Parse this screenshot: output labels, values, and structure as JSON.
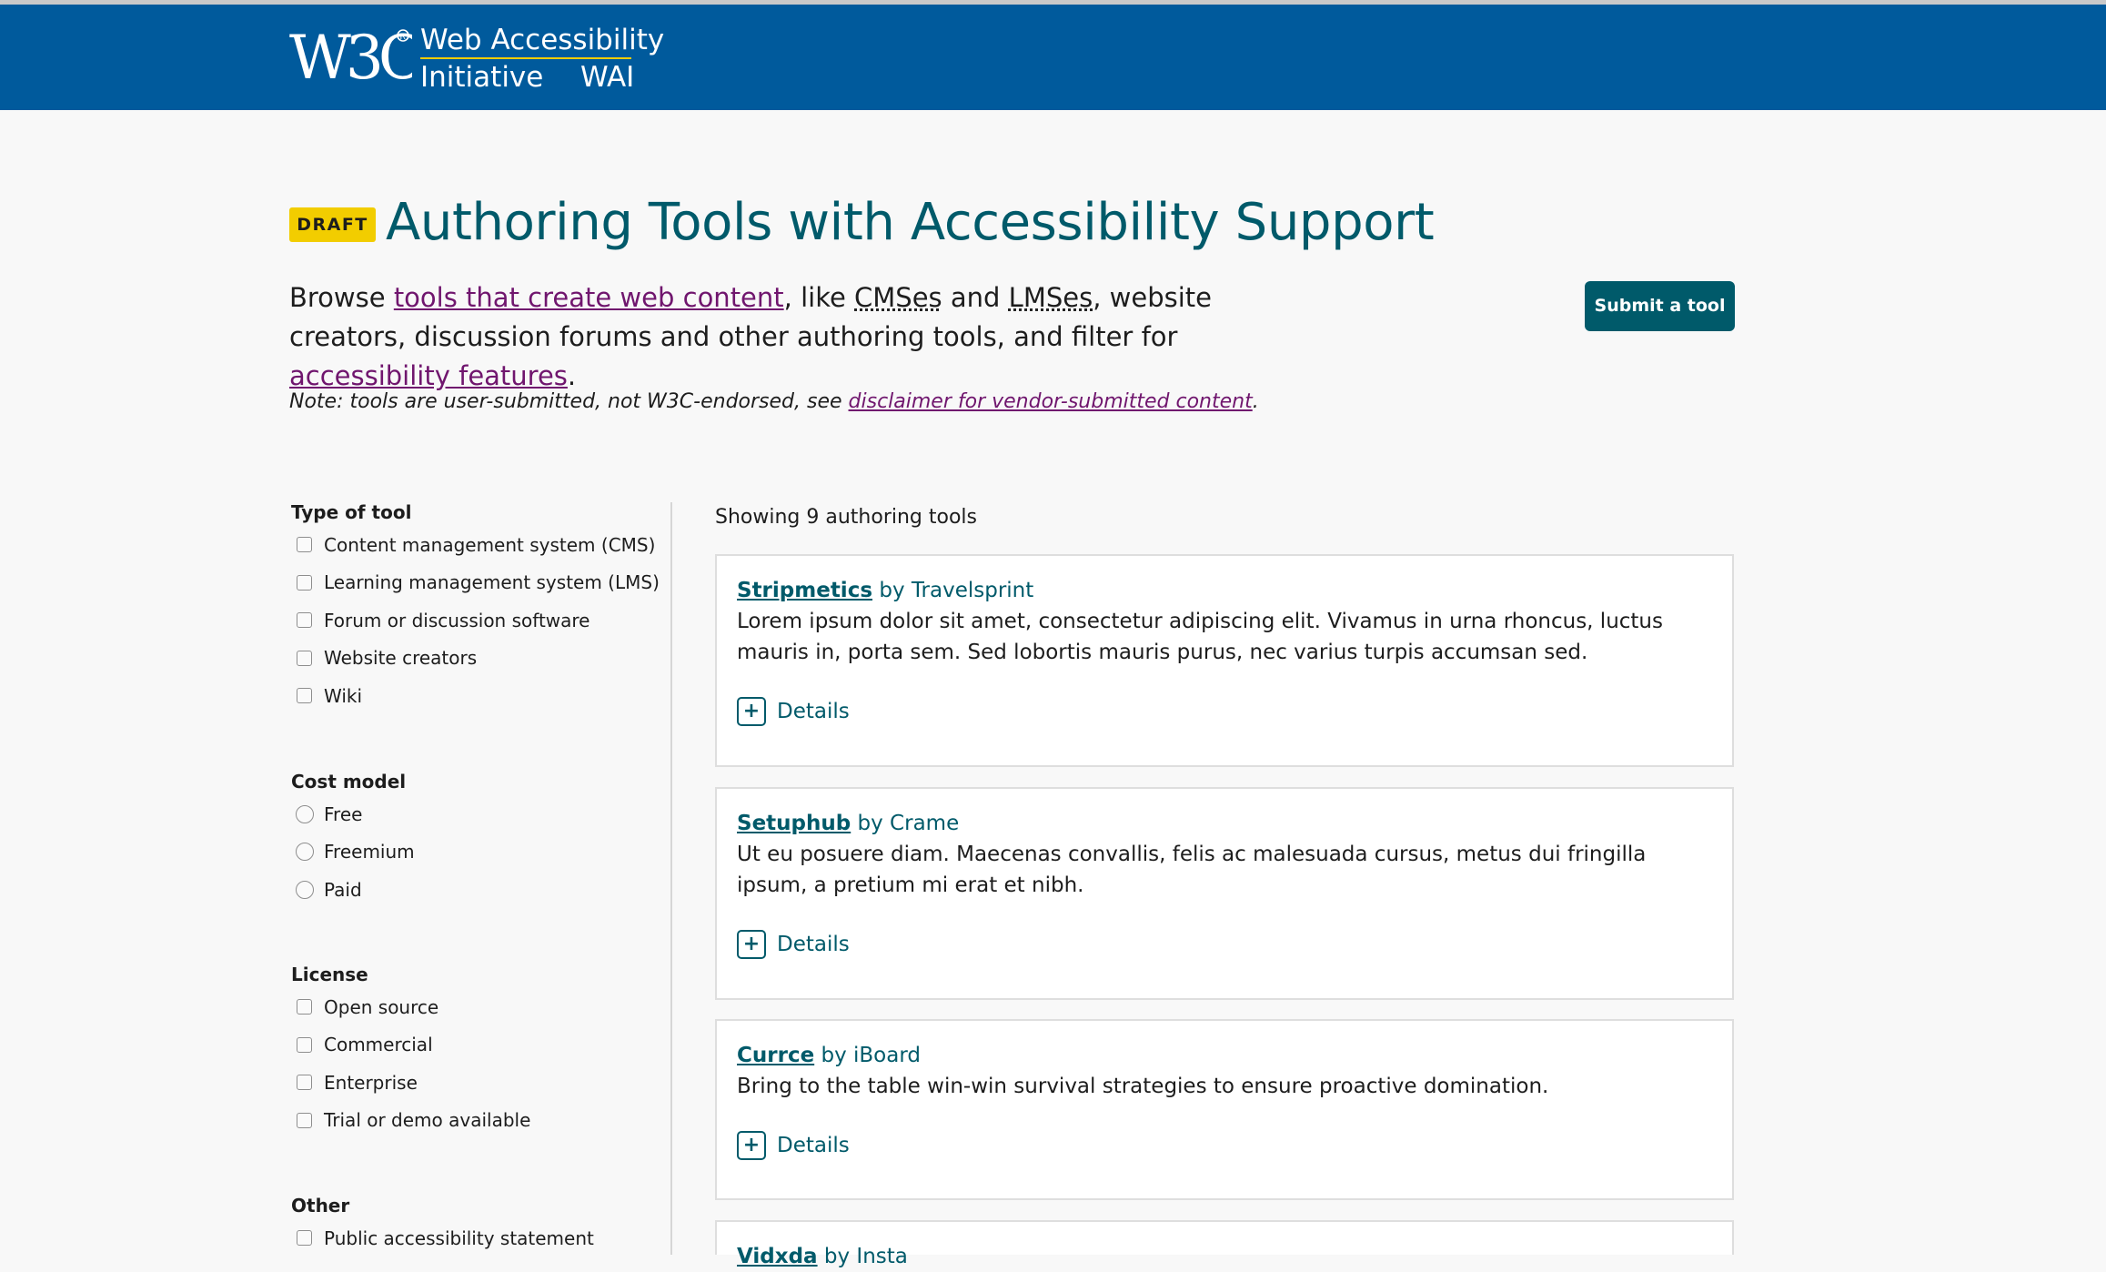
{
  "header": {
    "logo_line1": "Web Accessibility",
    "logo_line2": "Initiative",
    "logo_abbr": "WAI",
    "logo_mark_text": "W3C",
    "brand_color": "#005a9c",
    "accent_color": "#f2cd00"
  },
  "page": {
    "draft_badge": "DRAFT",
    "title": "Authoring Tools with Accessibility Support",
    "intro": {
      "t1": "Browse ",
      "link1": "tools that create web content",
      "t2": ", like ",
      "abbr1": "CMSes",
      "t3": " and ",
      "abbr2": "LMSes",
      "t4": ", website creators, discussion forums and other authoring tools, and filter for ",
      "link2": "accessibility features",
      "t5": "."
    },
    "submit_button": "Submit a tool",
    "note": {
      "text": "Note: tools are user-submitted, not W3C-endorsed, see ",
      "link": "disclaimer for vendor-submitted content",
      "end": "."
    },
    "title_color": "#005a6a",
    "link_color": "#70166e"
  },
  "filters": {
    "type_of_tool": {
      "heading": "Type of tool",
      "options": [
        "Content management system (CMS)",
        "Learning management system (LMS)",
        "Forum or discussion software",
        "Website creators",
        "Wiki"
      ]
    },
    "cost_model": {
      "heading": "Cost model",
      "options": [
        "Free",
        "Freemium",
        "Paid"
      ]
    },
    "license": {
      "heading": "License",
      "options": [
        "Open source",
        "Commercial",
        "Enterprise",
        "Trial or demo available"
      ]
    },
    "other": {
      "heading": "Other",
      "options": [
        "Public accessibility statement"
      ]
    }
  },
  "results": {
    "count_text": "Showing 9 authoring tools",
    "details_label": "Details",
    "tools": [
      {
        "name": "Stripmetics",
        "by": " by Travelsprint",
        "description": "Lorem ipsum dolor sit amet, consectetur adipiscing elit. Vivamus in urna rhoncus, luctus mauris in, porta sem. Sed lobortis mauris purus, nec varius turpis accumsan sed."
      },
      {
        "name": "Setuphub",
        "by": " by Crame",
        "description": "Ut eu posuere diam. Maecenas convallis, felis ac malesuada cursus, metus dui fringilla ipsum, a pretium mi erat et nibh."
      },
      {
        "name": "Currce",
        "by": " by iBoard",
        "description": "Bring to the table win-win survival strategies to ensure proactive domination."
      },
      {
        "name": "Vidxda",
        "by": " by Insta",
        "description": ""
      }
    ]
  }
}
